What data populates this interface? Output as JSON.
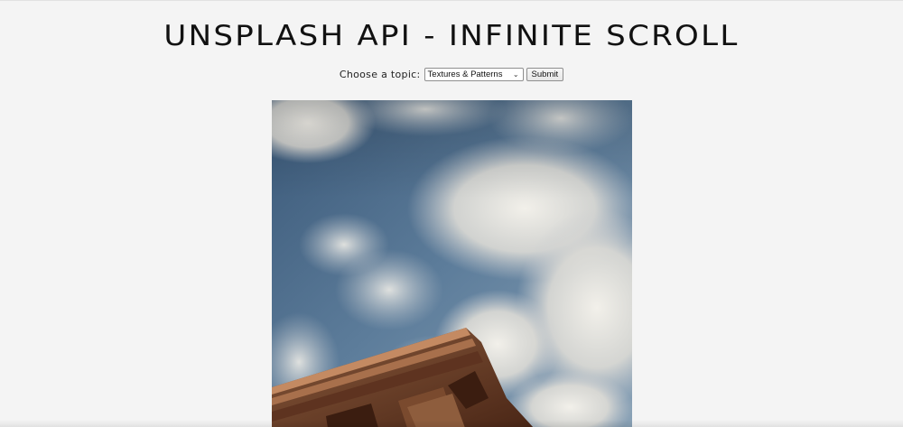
{
  "header": {
    "title": "UNSPLASH API - INFINITE SCROLL"
  },
  "controls": {
    "topic_label": "Choose a topic:",
    "topic_selected": "Textures & Patterns",
    "submit_label": "Submit"
  },
  "photo": {
    "subject": "photo-clouds-building"
  },
  "colors": {
    "background": "#f4f4f4",
    "title_text": "#111111",
    "sky": "#4f6f8f",
    "building": "#6e3f26"
  }
}
